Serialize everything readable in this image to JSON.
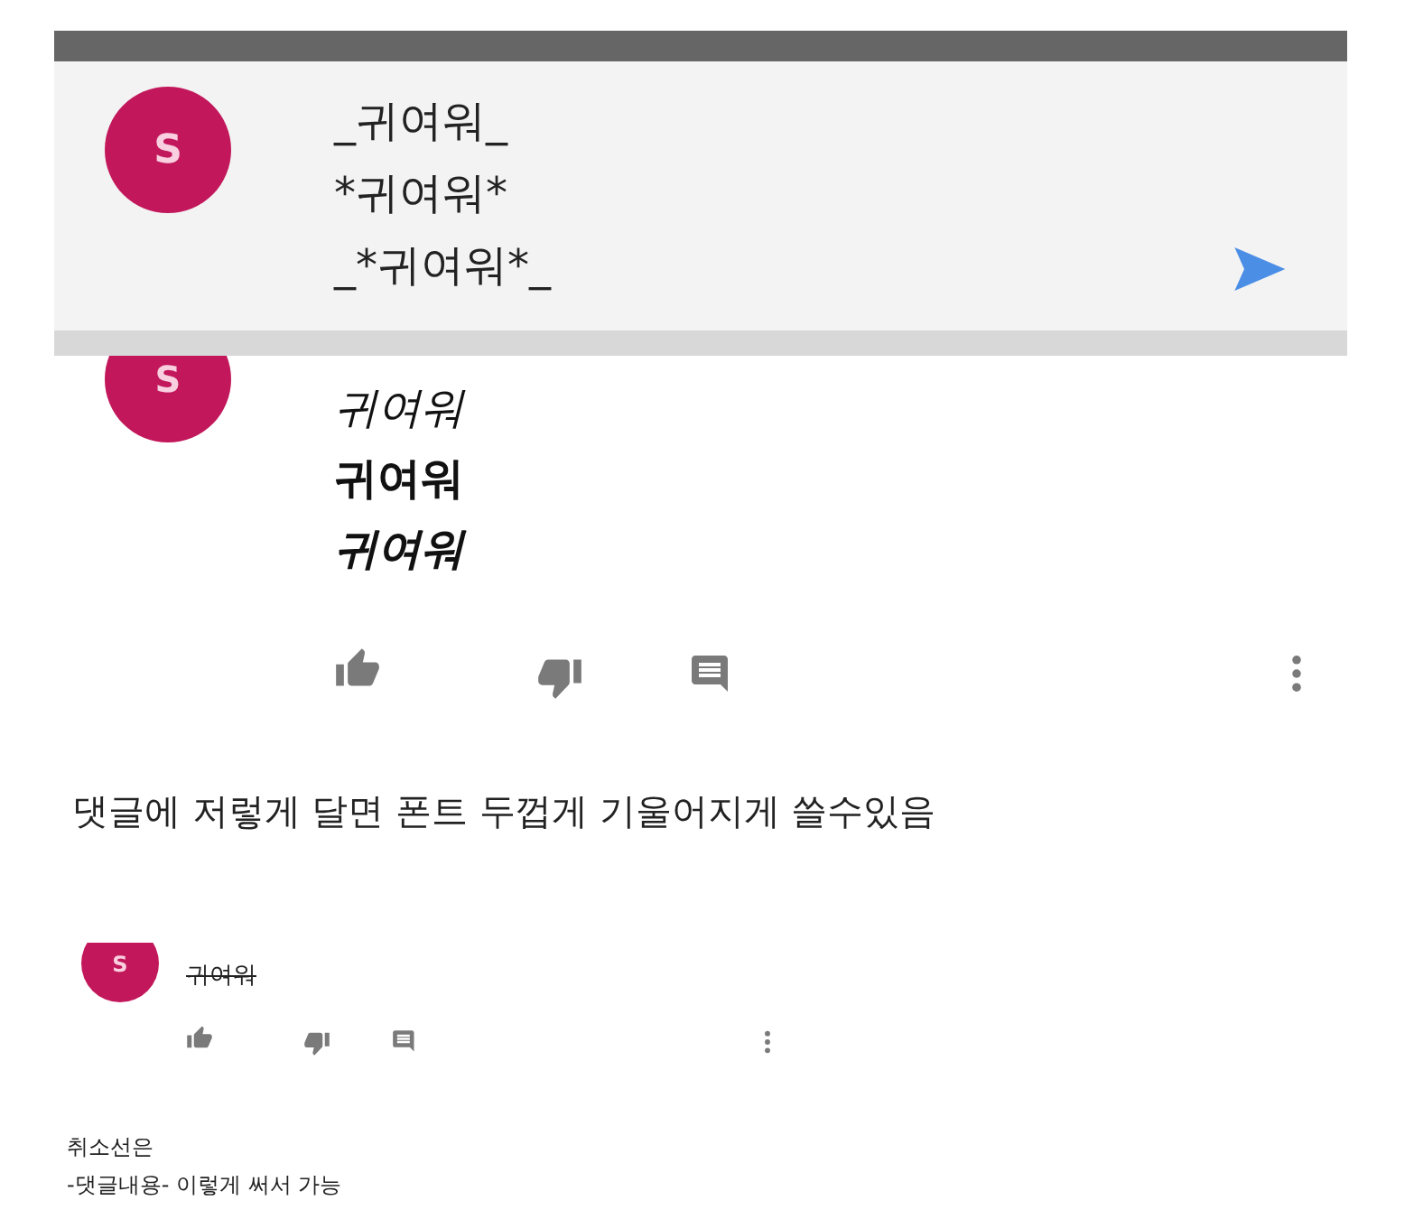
{
  "composer": {
    "avatar": "S",
    "lines": [
      "_귀여워_",
      "*귀여워*",
      "_*귀여워*_"
    ]
  },
  "comment": {
    "avatar": "S",
    "lines": [
      {
        "text": "귀여워",
        "kind": "italic"
      },
      {
        "text": "귀여워",
        "kind": "bold"
      },
      {
        "text": "귀여워",
        "kind": "bold-italic"
      }
    ]
  },
  "caption": "댓글에 저렇게 달면 폰트 두껍게 기울어지게 쓸수있음",
  "comment_small": {
    "avatar": "S",
    "text": "귀여워",
    "kind": "strikethrough"
  },
  "caption_lines": [
    "취소선은",
    "-댓글내용- 이렇게 써서 가능"
  ]
}
